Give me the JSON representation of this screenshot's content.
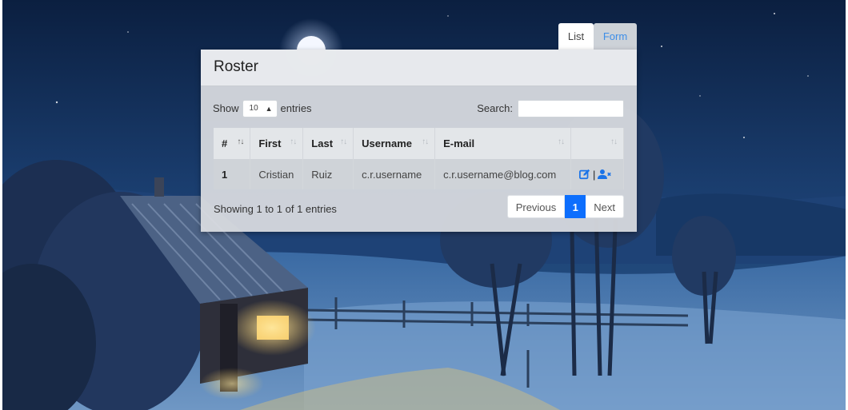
{
  "tabs": {
    "list_label": "List",
    "form_label": "Form"
  },
  "card": {
    "title": "Roster"
  },
  "controls": {
    "show_label": "Show",
    "entries_value": "10",
    "entries_label": "entries",
    "search_label": "Search:",
    "search_value": ""
  },
  "table": {
    "headers": {
      "num": "#",
      "first": "First",
      "last": "Last",
      "username": "Username",
      "email": "E-mail",
      "actions": ""
    },
    "rows": [
      {
        "num": "1",
        "first": "Cristian",
        "last": "Ruiz",
        "username": "c.r.username",
        "email": "c.r.username@blog.com"
      }
    ]
  },
  "footer": {
    "info": "Showing 1 to 1 of 1 entries",
    "previous": "Previous",
    "current_page": "1",
    "next": "Next"
  },
  "colors": {
    "accent": "#0d6efd",
    "link": "#3d8ee8",
    "night_sky": "#0e2548"
  },
  "icons": {
    "edit": "edit-icon",
    "remove_user": "user-remove-icon",
    "sort": "sort-icon",
    "select_caret": "caret-updown-icon"
  }
}
